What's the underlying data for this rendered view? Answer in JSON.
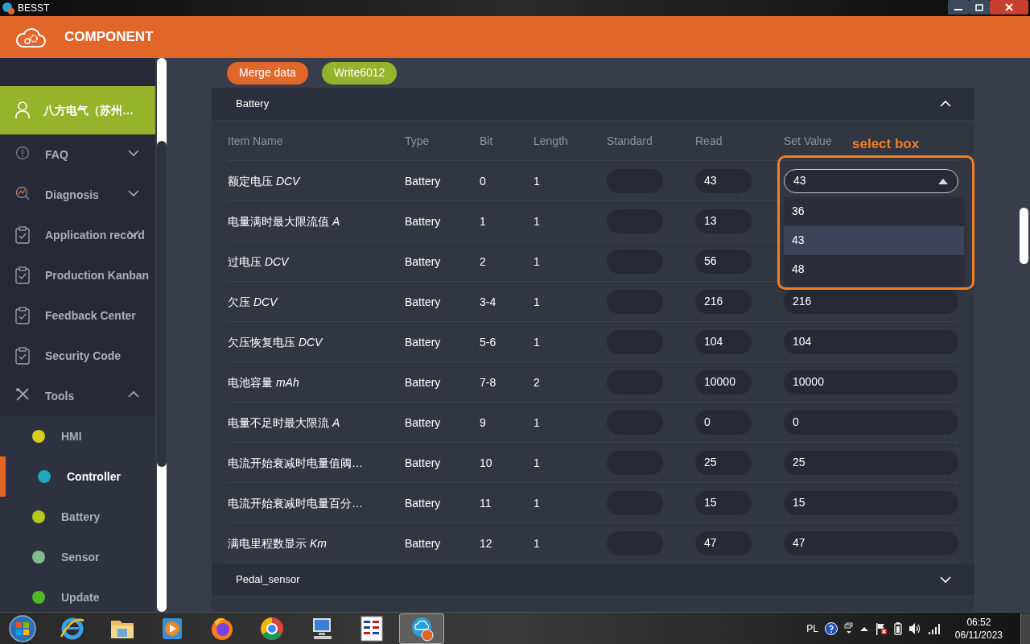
{
  "window": {
    "title": "BESST"
  },
  "header": {
    "title": "COMPONENT"
  },
  "sidebar": {
    "items": [
      {
        "kind": "user",
        "label": "八方电气（苏州…",
        "selected": false
      },
      {
        "kind": "group",
        "label": "FAQ",
        "expanded": false
      },
      {
        "kind": "group",
        "label": "Diagnosis",
        "expanded": false
      },
      {
        "kind": "group",
        "label": "Application record",
        "expanded": false
      },
      {
        "kind": "link",
        "label": "Production Kanban"
      },
      {
        "kind": "link",
        "label": "Feedback Center"
      },
      {
        "kind": "link",
        "label": "Security Code"
      },
      {
        "kind": "group",
        "label": "Tools",
        "expanded": true,
        "children": [
          {
            "label": "HMI",
            "color": "#d9cc1a",
            "selected": false
          },
          {
            "label": "Controller",
            "color": "#1fa8b8",
            "selected": true
          },
          {
            "label": "Battery",
            "color": "#b5c918",
            "selected": false
          },
          {
            "label": "Sensor",
            "color": "#7fbf8f",
            "selected": false
          },
          {
            "label": "Update",
            "color": "#4fba28",
            "selected": false
          }
        ]
      }
    ]
  },
  "actions": [
    {
      "label": "Merge data",
      "color": "#e0662a"
    },
    {
      "label": "Write6012",
      "color": "#97b32b"
    }
  ],
  "sections": [
    {
      "title": "Battery",
      "expanded": true,
      "columns": [
        "Item Name",
        "Type",
        "Bit",
        "Length",
        "Standard",
        "Read",
        "Set Value"
      ],
      "rows": [
        {
          "name": "额定电压 *DCV*",
          "type": "Battery",
          "bit": "0",
          "length": "1",
          "read": "43",
          "set_value": "43",
          "kind": "select",
          "dropdown": {
            "options": [
              {
                "label": "36",
                "selected": false
              },
              {
                "label": "43",
                "selected": true
              },
              {
                "label": "48",
                "selected": false
              }
            ]
          }
        },
        {
          "name": "电量满时最大限流值 *A*",
          "type": "Battery",
          "bit": "1",
          "length": "1",
          "read": "13"
        },
        {
          "name": "过电压 *DCV*",
          "type": "Battery",
          "bit": "2",
          "length": "1",
          "read": "56"
        },
        {
          "name": "欠压 *DCV*",
          "type": "Battery",
          "bit": "3-4",
          "length": "1",
          "read": "216",
          "set_value": "216"
        },
        {
          "name": "欠压恢复电压 *DCV*",
          "type": "Battery",
          "bit": "5-6",
          "length": "1",
          "read": "104",
          "set_value": "104"
        },
        {
          "name": "电池容量 *mAh*",
          "type": "Battery",
          "bit": "7-8",
          "length": "2",
          "read": "10000",
          "set_value": "10000"
        },
        {
          "name": "电量不足时最大限流 *A*",
          "type": "Battery",
          "bit": "9",
          "length": "1",
          "read": "0",
          "set_value": "0"
        },
        {
          "name": "电流开始衰减时电量值阈…",
          "type": "Battery",
          "bit": "10",
          "length": "1",
          "read": "25",
          "set_value": "25"
        },
        {
          "name": "电流开始衰减时电量百分…",
          "type": "Battery",
          "bit": "11",
          "length": "1",
          "read": "15",
          "set_value": "15"
        },
        {
          "name": "满电里程数显示 *Km*",
          "type": "Battery",
          "bit": "12",
          "length": "1",
          "read": "47",
          "set_value": "47"
        }
      ]
    },
    {
      "title": "Pedal_sensor",
      "expanded": false
    }
  ],
  "annotation": {
    "label": "select box"
  },
  "taskbar": {
    "apps": [
      {
        "kind": "start",
        "selected": false
      },
      {
        "kind": "ie",
        "selected": false
      },
      {
        "kind": "folder",
        "selected": false
      },
      {
        "kind": "media",
        "selected": false
      },
      {
        "kind": "firefox",
        "selected": false
      },
      {
        "kind": "chrome",
        "selected": false
      },
      {
        "kind": "computer",
        "selected": false
      },
      {
        "kind": "calc",
        "selected": false
      },
      {
        "kind": "besst",
        "selected": true
      }
    ],
    "language": "PL",
    "time": "06:52",
    "date": "06/11/2023"
  }
}
